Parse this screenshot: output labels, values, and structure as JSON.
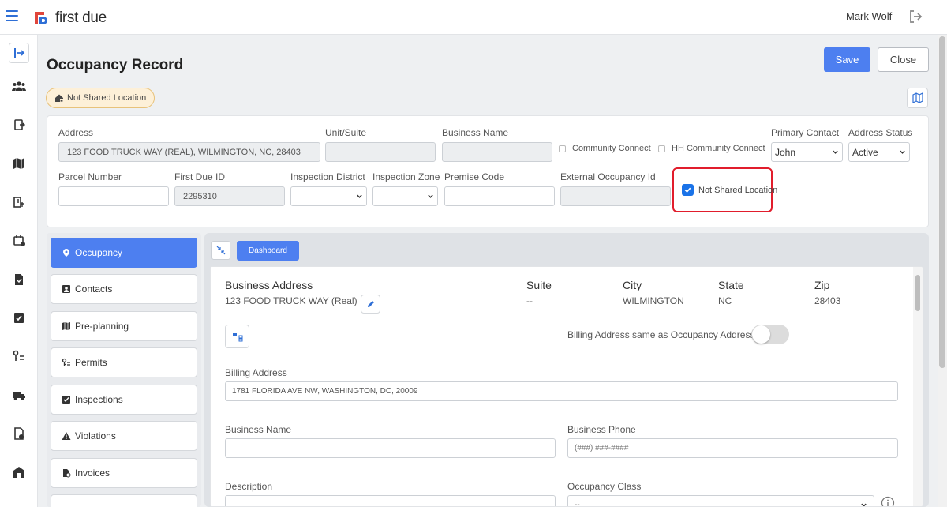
{
  "app": {
    "brand": "first due",
    "user_name": "Mark Wolf"
  },
  "page": {
    "title": "Occupancy Record",
    "save_label": "Save",
    "close_label": "Close",
    "badge_label": "Not Shared Location"
  },
  "form": {
    "address": {
      "label": "Address",
      "value": "123 FOOD TRUCK WAY (REAL), WILMINGTON, NC, 28403"
    },
    "unit_suite": {
      "label": "Unit/Suite",
      "value": ""
    },
    "business_name": {
      "label": "Business Name",
      "value": ""
    },
    "community_connect_label": "Community Connect",
    "hh_community_connect_label": "HH Community Connect",
    "primary_contact": {
      "label": "Primary Contact",
      "value": "John"
    },
    "address_status": {
      "label": "Address Status",
      "value": "Active"
    },
    "parcel_number": {
      "label": "Parcel Number",
      "value": ""
    },
    "first_due_id": {
      "label": "First Due ID",
      "value": "2295310"
    },
    "inspection_district": {
      "label": "Inspection District",
      "value": ""
    },
    "inspection_zone": {
      "label": "Inspection Zone",
      "value": ""
    },
    "premise_code": {
      "label": "Premise Code",
      "value": ""
    },
    "external_occupancy_id": {
      "label": "External Occupancy Id",
      "value": ""
    },
    "not_shared_location": {
      "label": "Not Shared Location",
      "checked": true
    }
  },
  "tabs": [
    {
      "label": "Occupancy",
      "icon": "map-pin-icon",
      "active": true
    },
    {
      "label": "Contacts",
      "icon": "contact-card-icon"
    },
    {
      "label": "Pre-planning",
      "icon": "map-icon"
    },
    {
      "label": "Permits",
      "icon": "permit-key-icon"
    },
    {
      "label": "Inspections",
      "icon": "checkbox-icon"
    },
    {
      "label": "Violations",
      "icon": "warning-icon"
    },
    {
      "label": "Invoices",
      "icon": "invoice-icon"
    }
  ],
  "content": {
    "dashboard_label": "Dashboard",
    "business_address": {
      "label": "Business Address",
      "value": "123 FOOD TRUCK WAY (Real)"
    },
    "suite": {
      "label": "Suite",
      "value": "--"
    },
    "city": {
      "label": "City",
      "value": "WILMINGTON"
    },
    "state": {
      "label": "State",
      "value": "NC"
    },
    "zip": {
      "label": "Zip",
      "value": "28403"
    },
    "billing_same_label": "Billing Address same as Occupancy Address",
    "billing_same_on": false,
    "billing_address": {
      "label": "Billing Address",
      "value": "1781 FLORIDA AVE NW, WASHINGTON, DC, 20009"
    },
    "business_name": {
      "label": "Business Name",
      "value": ""
    },
    "business_phone": {
      "label": "Business Phone",
      "placeholder": "(###) ###-####"
    },
    "description": {
      "label": "Description"
    },
    "occupancy_class": {
      "label": "Occupancy Class",
      "value": "--"
    }
  },
  "colors": {
    "primary": "#4d7ff0",
    "highlight": "#e11d2c",
    "badge_bg": "#fdf0d8"
  }
}
